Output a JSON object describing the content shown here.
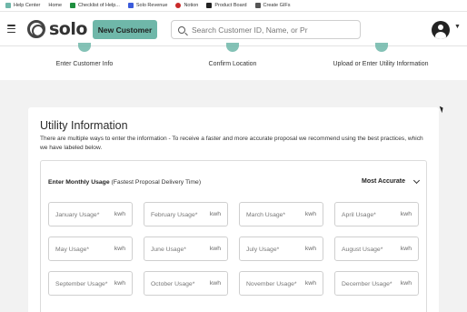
{
  "bookmarks": [
    {
      "label": "Help Center",
      "color": "#6fb7a9"
    },
    {
      "label": "Home",
      "color": "#ffffff"
    },
    {
      "label": "Checklist of Help...",
      "color": "#1e8e3e"
    },
    {
      "label": "Solo Revenue",
      "color": "#3b5bdb"
    },
    {
      "label": "Notion",
      "color": "#222222"
    },
    {
      "label": "Product Board",
      "color": "#d9480f"
    },
    {
      "label": "Create GIFs",
      "color": "#444444"
    }
  ],
  "header": {
    "logo_text": "solo",
    "new_customer_label": "New Customer",
    "search_placeholder": "Search Customer ID, Name, or Pr",
    "accent_color": "#6fb7a9"
  },
  "stepper": {
    "steps": [
      {
        "label": "Enter Customer Info"
      },
      {
        "label": "Confirm Location"
      },
      {
        "label": "Upload or Enter Utility Information"
      }
    ]
  },
  "utility": {
    "title": "Utility Information",
    "description": "There are multiple ways to enter the information - To receive a faster and more accurate proposal we recommend using the best practices, which we have labeled below.",
    "usage_header_bold": "Enter Monthly Usage",
    "usage_header_note": " (Fastest Proposal Delivery Time)",
    "accuracy_label": "Most Accurate",
    "unit": "kwh",
    "months": [
      "January Usage*",
      "February Usage*",
      "March Usage*",
      "April Usage*",
      "May Usage*",
      "June Usage*",
      "July Usage*",
      "August Usage*",
      "September Usage*",
      "October Usage*",
      "November Usage*",
      "December Usage*"
    ]
  }
}
